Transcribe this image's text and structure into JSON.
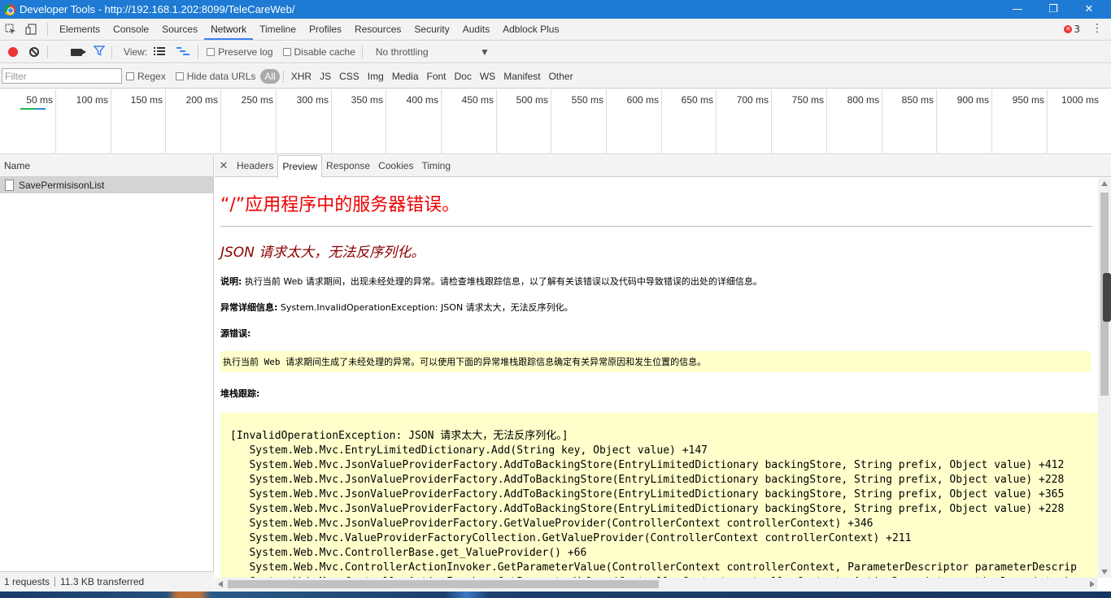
{
  "window": {
    "title": "Developer Tools - http://192.168.1.202:8099/TeleCareWeb/",
    "minimize": "—",
    "restore": "❐",
    "close": "✕"
  },
  "tabs": [
    "Elements",
    "Console",
    "Sources",
    "Network",
    "Timeline",
    "Profiles",
    "Resources",
    "Security",
    "Audits",
    "Adblock Plus"
  ],
  "active_tab": "Network",
  "error_count": "3",
  "network_toolbar": {
    "view_label": "View:",
    "preserve_log": "Preserve log",
    "disable_cache": "Disable cache",
    "throttling": "No throttling"
  },
  "filter_bar": {
    "placeholder": "Filter",
    "regex": "Regex",
    "hide_data_urls": "Hide data URLs",
    "types": [
      "All",
      "XHR",
      "JS",
      "CSS",
      "Img",
      "Media",
      "Font",
      "Doc",
      "WS",
      "Manifest",
      "Other"
    ]
  },
  "overview_ticks": [
    "50 ms",
    "100 ms",
    "150 ms",
    "200 ms",
    "250 ms",
    "300 ms",
    "350 ms",
    "400 ms",
    "450 ms",
    "500 ms",
    "550 ms",
    "600 ms",
    "650 ms",
    "700 ms",
    "750 ms",
    "800 ms",
    "850 ms",
    "900 ms",
    "950 ms",
    "1000 ms"
  ],
  "request_list": {
    "header": "Name",
    "rows": [
      "SavePermisisonList"
    ]
  },
  "status": {
    "requests": "1 requests",
    "transferred": "11.3 KB transferred"
  },
  "detail_tabs": [
    "Headers",
    "Preview",
    "Response",
    "Cookies",
    "Timing"
  ],
  "active_detail_tab": "Preview",
  "preview": {
    "title": "“/”应用程序中的服务器错误。",
    "subtitle": "JSON 请求太大，无法反序列化。",
    "desc_label": "说明:",
    "desc_text": " 执行当前 Web 请求期间，出现未经处理的异常。请检查堆栈跟踪信息，以了解有关该错误以及代码中导致错误的出处的详细信息。",
    "exc_label": "异常详细信息:",
    "exc_text": " System.InvalidOperationException: JSON 请求太大，无法反序列化。",
    "src_label": "源错误:",
    "src_text": "执行当前 Web 请求期间生成了未经处理的异常。可以使用下面的异常堆栈跟踪信息确定有关异常原因和发生位置的信息。",
    "stack_label": "堆栈跟踪:",
    "stack_lines": [
      "[InvalidOperationException: JSON 请求太大，无法反序列化。]",
      "   System.Web.Mvc.EntryLimitedDictionary.Add(String key, Object value) +147",
      "   System.Web.Mvc.JsonValueProviderFactory.AddToBackingStore(EntryLimitedDictionary backingStore, String prefix, Object value) +412",
      "   System.Web.Mvc.JsonValueProviderFactory.AddToBackingStore(EntryLimitedDictionary backingStore, String prefix, Object value) +228",
      "   System.Web.Mvc.JsonValueProviderFactory.AddToBackingStore(EntryLimitedDictionary backingStore, String prefix, Object value) +365",
      "   System.Web.Mvc.JsonValueProviderFactory.AddToBackingStore(EntryLimitedDictionary backingStore, String prefix, Object value) +228",
      "   System.Web.Mvc.JsonValueProviderFactory.GetValueProvider(ControllerContext controllerContext) +346",
      "   System.Web.Mvc.ValueProviderFactoryCollection.GetValueProvider(ControllerContext controllerContext) +211",
      "   System.Web.Mvc.ControllerBase.get_ValueProvider() +66",
      "   System.Web.Mvc.ControllerActionInvoker.GetParameterValue(ControllerContext controllerContext, ParameterDescriptor parameterDescrip",
      "   System.Web.Mvc.ControllerActionInvoker.GetParameterValues(ControllerContext controllerContext, ActionDescriptor actionDescriptor)"
    ]
  },
  "colors": {
    "titlebar": "#1e7ad3",
    "accent": "#3e82f7",
    "error_red": "#e00000",
    "highlight_yellow": "#ffffcc"
  }
}
